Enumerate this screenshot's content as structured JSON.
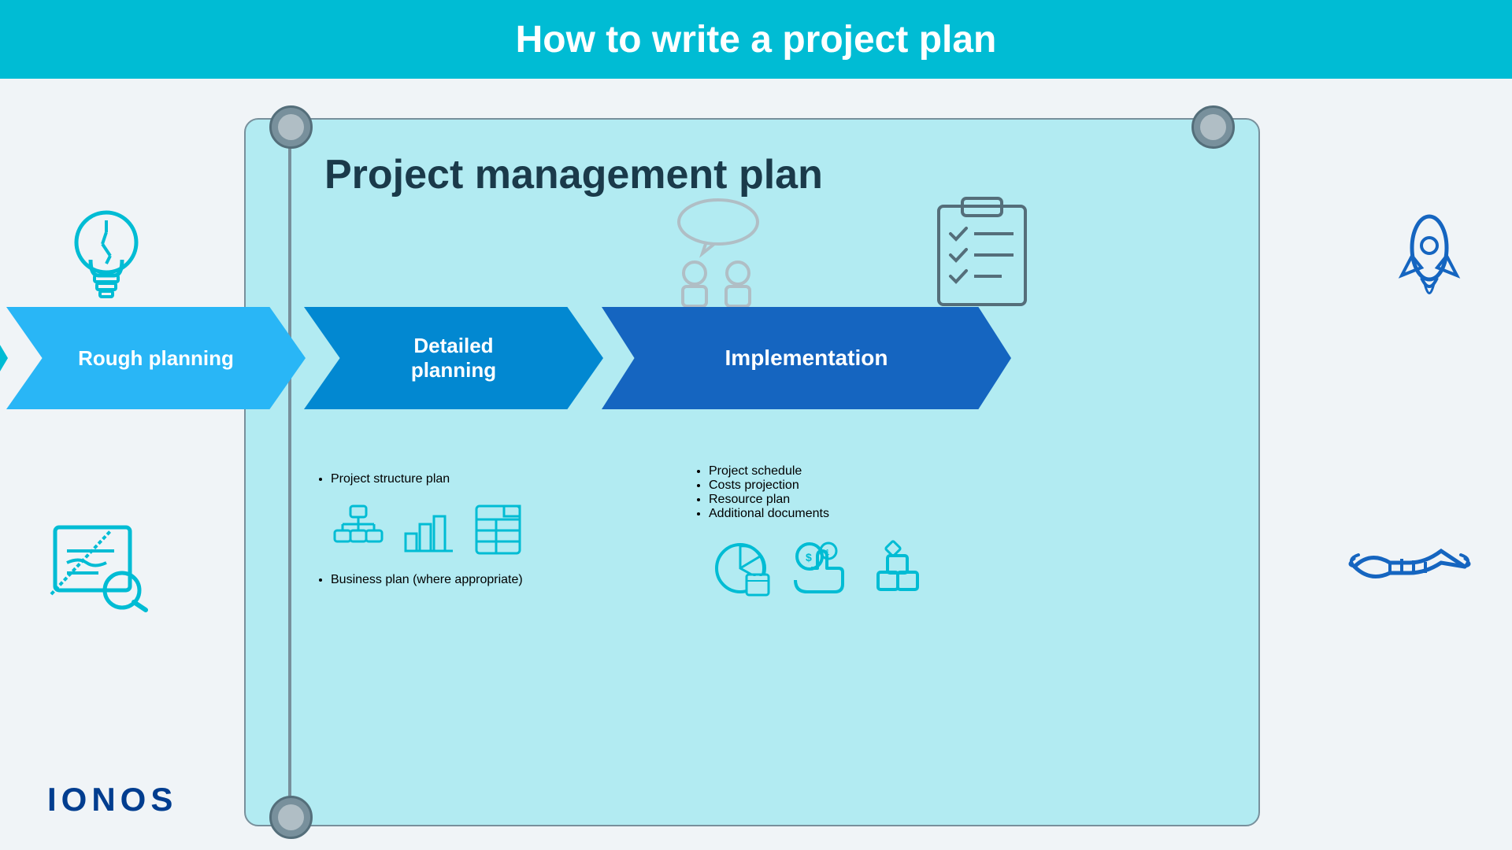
{
  "page": {
    "title": "How to write a project plan",
    "background_color": "#f0f4f7",
    "banner_color": "#00bcd4"
  },
  "scroll": {
    "title": "Project management plan"
  },
  "arrows": [
    {
      "id": "idea",
      "label": "Idea",
      "color": "#00bcd4"
    },
    {
      "id": "rough",
      "label": "Rough planning",
      "color": "#29b6f6"
    },
    {
      "id": "detailed",
      "label": "Detailed planning",
      "color": "#0288d1"
    },
    {
      "id": "implementation",
      "label": "Implementation",
      "color": "#1565c0"
    }
  ],
  "rough_planning": {
    "items": [
      "Project structure plan",
      "Business plan (where appropriate)"
    ]
  },
  "detailed_planning": {
    "items": [
      "Project schedule",
      "Costs projection",
      "Resource plan",
      "Additional documents"
    ]
  },
  "logo": {
    "text": "IONOS"
  }
}
